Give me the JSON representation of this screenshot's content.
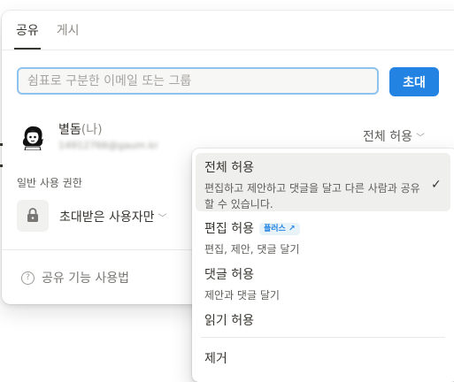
{
  "tabs": [
    {
      "label": "공유",
      "active": true
    },
    {
      "label": "게시",
      "active": false
    }
  ],
  "invite": {
    "placeholder": "쉼표로 구분한 이메일 또는 그룹",
    "button_label": "초대"
  },
  "user": {
    "name": "별돔",
    "me_tag": "(나)",
    "email": "14912766@gaum.kr",
    "permission": "전체 허용"
  },
  "general_access": {
    "label": "일반 사용 권한",
    "value": "초대받은 사용자만"
  },
  "help": {
    "label": "공유 기능 사용법"
  },
  "dropdown": {
    "options": [
      {
        "title": "전체 허용",
        "desc": "편집하고 제안하고 댓글을 달고 다른 사람과 공유할 수 있습니다.",
        "selected": true
      },
      {
        "title": "편집 허용",
        "badge": "플러스 ↗",
        "desc": "편집, 제안, 댓글 달기"
      },
      {
        "title": "댓글 허용",
        "desc": "제안과 댓글 달기"
      },
      {
        "title": "읽기 허용"
      }
    ],
    "remove_label": "제거"
  },
  "colors": {
    "accent": "#2383e2",
    "input_focus_border": "#8fc3ef",
    "selected_bg": "#efefed"
  }
}
